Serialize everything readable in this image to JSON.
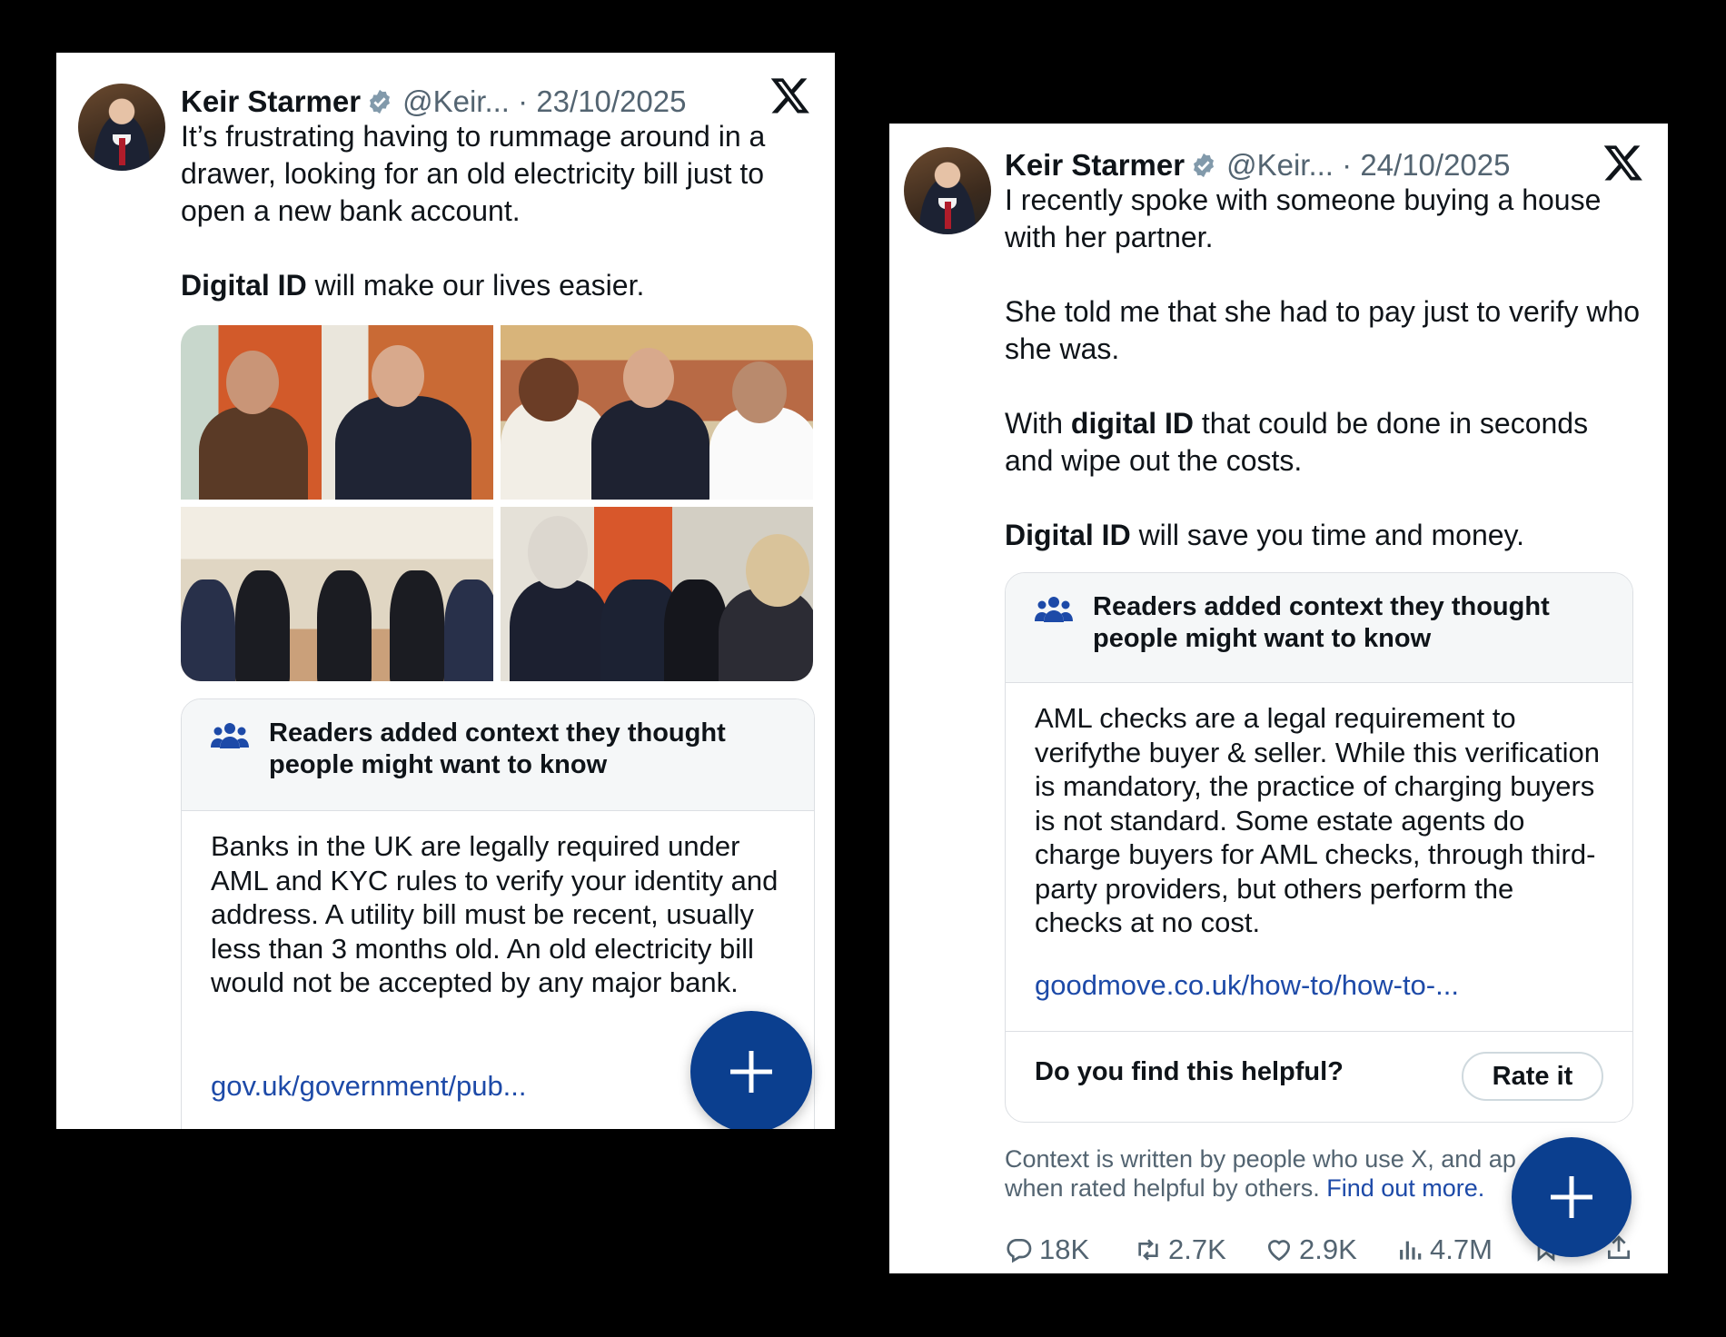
{
  "left_post": {
    "author": {
      "name": "Keir Starmer",
      "handle": "@Keir...",
      "separator": "·",
      "date": "23/10/2025"
    },
    "text": {
      "p1": "It’s frustrating having to rummage around in a drawer, looking for an old electricity bill just to open a new bank account.",
      "p2_bold": "Digital ID",
      "p2_rest": " will make our lives easier."
    },
    "images": [
      "photo-1",
      "photo-2",
      "photo-3",
      "photo-4"
    ],
    "note": {
      "title": "Readers added context they thought people might want to know",
      "body": "Banks in the UK are legally required under AML and KYC rules to verify your identity and address. A utility bill must be recent, usually less than 3 months old. An old electricity bill would not be accepted by any major bank.",
      "link": "gov.uk/government/pub..."
    }
  },
  "right_post": {
    "author": {
      "name": "Keir Starmer",
      "handle": "@Keir...",
      "separator": "·",
      "date": "24/10/2025"
    },
    "text": {
      "p1": "I recently spoke with someone buying a house with her partner.",
      "p2": "She told me that she had to pay just to verify who she was.",
      "p3_pre": "With ",
      "p3_bold": "digital ID",
      "p3_rest": " that could be done in seconds and wipe out the costs.",
      "p4_bold": "Digital ID",
      "p4_rest": " will save you time and money."
    },
    "note": {
      "title": "Readers added context they thought people might want to know",
      "body": "AML checks are a legal requirement to verifythe buyer & seller. While this verification is mandatory, the practice of charging buyers is not standard. Some estate agents do charge buyers for AML checks, through third-party providers, but others perform the checks at no cost.",
      "link": "goodmove.co.uk/how-to/how-to-...",
      "helpful_question": "Do you find this helpful?",
      "rate_label": "Rate it"
    },
    "context_footer": {
      "line1": "Context is written by people who use X, and ap",
      "line2": "when rated helpful by others.",
      "link": "Find out more."
    },
    "stats": {
      "replies": "18K",
      "reposts": "2.7K",
      "likes": "2.9K",
      "views": "4.7M"
    }
  },
  "colors": {
    "link": "#1d4aa8",
    "fab": "#0b3f8f",
    "verified": "#829aab",
    "muted": "#536471"
  },
  "icons": [
    "x-logo-icon",
    "verified-badge-icon",
    "people-icon",
    "plus-icon",
    "reply-icon",
    "repost-icon",
    "like-icon",
    "views-icon",
    "bookmark-icon",
    "share-icon"
  ]
}
